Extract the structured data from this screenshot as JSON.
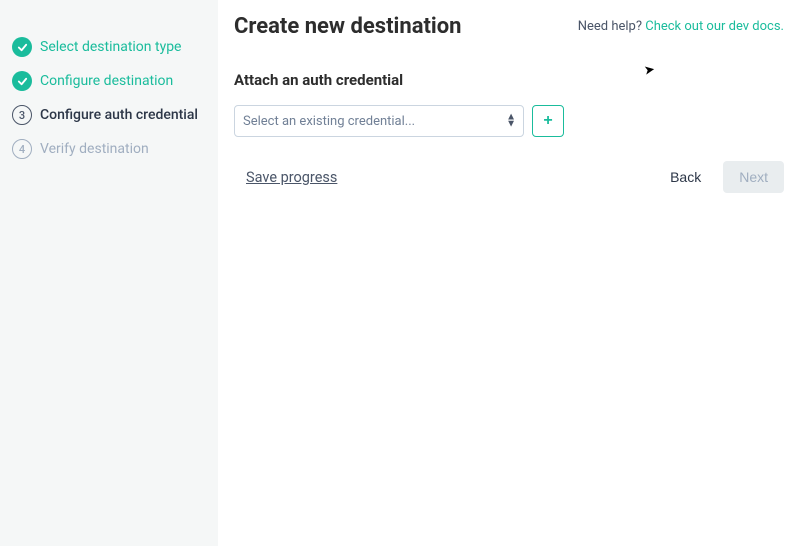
{
  "sidebar": {
    "steps": [
      {
        "label": "Select destination type",
        "state": "done",
        "num": ""
      },
      {
        "label": "Configure destination",
        "state": "done",
        "num": ""
      },
      {
        "label": "Configure auth credential",
        "state": "current",
        "num": "3"
      },
      {
        "label": "Verify destination",
        "state": "pending",
        "num": "4"
      }
    ]
  },
  "header": {
    "title": "Create new destination",
    "help_prefix": "Need help? ",
    "help_link": "Check out our dev docs."
  },
  "section": {
    "title": "Attach an auth credential"
  },
  "credential_select": {
    "placeholder": "Select an existing credential..."
  },
  "actions": {
    "add": "+",
    "save": "Save progress",
    "back": "Back",
    "next": "Next"
  }
}
